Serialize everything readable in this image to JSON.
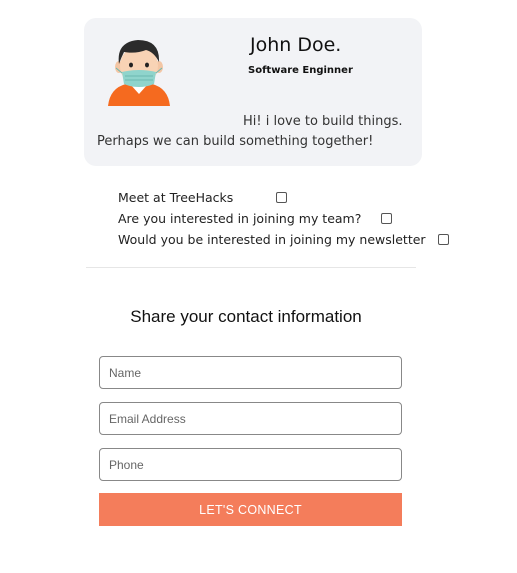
{
  "profile": {
    "name": "John Doe.",
    "role": "Software Enginner",
    "bio_line_1": "Hi! i love to build things.",
    "bio_line_2": "Perhaps we can build something together!",
    "avatar_icon": "masked-person-avatar-icon"
  },
  "options": [
    {
      "label": "Meet at TreeHacks",
      "checked": false
    },
    {
      "label": "Are you interested in joining my team?",
      "checked": false
    },
    {
      "label": "Would you be interested in joining my newsletter",
      "checked": false
    }
  ],
  "contact": {
    "heading": "Share your contact information",
    "name_placeholder": "Name",
    "email_placeholder": "Email Address",
    "phone_placeholder": "Phone",
    "button_label": "LET'S CONNECT"
  },
  "colors": {
    "card_background": "#f2f3f6",
    "button_accent": "#f47d5b"
  }
}
